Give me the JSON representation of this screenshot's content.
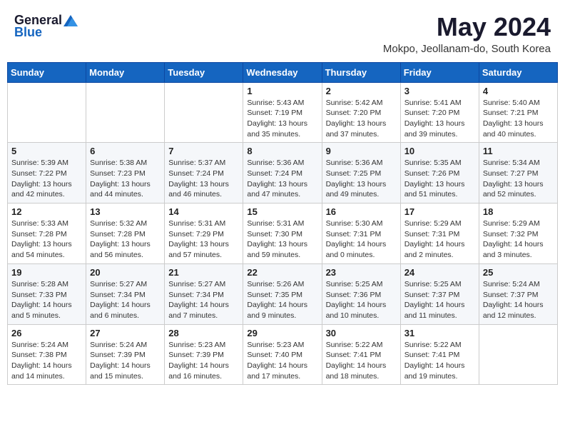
{
  "header": {
    "logo_general": "General",
    "logo_blue": "Blue",
    "month_title": "May 2024",
    "subtitle": "Mokpo, Jeollanam-do, South Korea"
  },
  "days_of_week": [
    "Sunday",
    "Monday",
    "Tuesday",
    "Wednesday",
    "Thursday",
    "Friday",
    "Saturday"
  ],
  "weeks": [
    [
      {
        "day": "",
        "info": ""
      },
      {
        "day": "",
        "info": ""
      },
      {
        "day": "",
        "info": ""
      },
      {
        "day": "1",
        "info": "Sunrise: 5:43 AM\nSunset: 7:19 PM\nDaylight: 13 hours\nand 35 minutes."
      },
      {
        "day": "2",
        "info": "Sunrise: 5:42 AM\nSunset: 7:20 PM\nDaylight: 13 hours\nand 37 minutes."
      },
      {
        "day": "3",
        "info": "Sunrise: 5:41 AM\nSunset: 7:20 PM\nDaylight: 13 hours\nand 39 minutes."
      },
      {
        "day": "4",
        "info": "Sunrise: 5:40 AM\nSunset: 7:21 PM\nDaylight: 13 hours\nand 40 minutes."
      }
    ],
    [
      {
        "day": "5",
        "info": "Sunrise: 5:39 AM\nSunset: 7:22 PM\nDaylight: 13 hours\nand 42 minutes."
      },
      {
        "day": "6",
        "info": "Sunrise: 5:38 AM\nSunset: 7:23 PM\nDaylight: 13 hours\nand 44 minutes."
      },
      {
        "day": "7",
        "info": "Sunrise: 5:37 AM\nSunset: 7:24 PM\nDaylight: 13 hours\nand 46 minutes."
      },
      {
        "day": "8",
        "info": "Sunrise: 5:36 AM\nSunset: 7:24 PM\nDaylight: 13 hours\nand 47 minutes."
      },
      {
        "day": "9",
        "info": "Sunrise: 5:36 AM\nSunset: 7:25 PM\nDaylight: 13 hours\nand 49 minutes."
      },
      {
        "day": "10",
        "info": "Sunrise: 5:35 AM\nSunset: 7:26 PM\nDaylight: 13 hours\nand 51 minutes."
      },
      {
        "day": "11",
        "info": "Sunrise: 5:34 AM\nSunset: 7:27 PM\nDaylight: 13 hours\nand 52 minutes."
      }
    ],
    [
      {
        "day": "12",
        "info": "Sunrise: 5:33 AM\nSunset: 7:28 PM\nDaylight: 13 hours\nand 54 minutes."
      },
      {
        "day": "13",
        "info": "Sunrise: 5:32 AM\nSunset: 7:28 PM\nDaylight: 13 hours\nand 56 minutes."
      },
      {
        "day": "14",
        "info": "Sunrise: 5:31 AM\nSunset: 7:29 PM\nDaylight: 13 hours\nand 57 minutes."
      },
      {
        "day": "15",
        "info": "Sunrise: 5:31 AM\nSunset: 7:30 PM\nDaylight: 13 hours\nand 59 minutes."
      },
      {
        "day": "16",
        "info": "Sunrise: 5:30 AM\nSunset: 7:31 PM\nDaylight: 14 hours\nand 0 minutes."
      },
      {
        "day": "17",
        "info": "Sunrise: 5:29 AM\nSunset: 7:31 PM\nDaylight: 14 hours\nand 2 minutes."
      },
      {
        "day": "18",
        "info": "Sunrise: 5:29 AM\nSunset: 7:32 PM\nDaylight: 14 hours\nand 3 minutes."
      }
    ],
    [
      {
        "day": "19",
        "info": "Sunrise: 5:28 AM\nSunset: 7:33 PM\nDaylight: 14 hours\nand 5 minutes."
      },
      {
        "day": "20",
        "info": "Sunrise: 5:27 AM\nSunset: 7:34 PM\nDaylight: 14 hours\nand 6 minutes."
      },
      {
        "day": "21",
        "info": "Sunrise: 5:27 AM\nSunset: 7:34 PM\nDaylight: 14 hours\nand 7 minutes."
      },
      {
        "day": "22",
        "info": "Sunrise: 5:26 AM\nSunset: 7:35 PM\nDaylight: 14 hours\nand 9 minutes."
      },
      {
        "day": "23",
        "info": "Sunrise: 5:25 AM\nSunset: 7:36 PM\nDaylight: 14 hours\nand 10 minutes."
      },
      {
        "day": "24",
        "info": "Sunrise: 5:25 AM\nSunset: 7:37 PM\nDaylight: 14 hours\nand 11 minutes."
      },
      {
        "day": "25",
        "info": "Sunrise: 5:24 AM\nSunset: 7:37 PM\nDaylight: 14 hours\nand 12 minutes."
      }
    ],
    [
      {
        "day": "26",
        "info": "Sunrise: 5:24 AM\nSunset: 7:38 PM\nDaylight: 14 hours\nand 14 minutes."
      },
      {
        "day": "27",
        "info": "Sunrise: 5:24 AM\nSunset: 7:39 PM\nDaylight: 14 hours\nand 15 minutes."
      },
      {
        "day": "28",
        "info": "Sunrise: 5:23 AM\nSunset: 7:39 PM\nDaylight: 14 hours\nand 16 minutes."
      },
      {
        "day": "29",
        "info": "Sunrise: 5:23 AM\nSunset: 7:40 PM\nDaylight: 14 hours\nand 17 minutes."
      },
      {
        "day": "30",
        "info": "Sunrise: 5:22 AM\nSunset: 7:41 PM\nDaylight: 14 hours\nand 18 minutes."
      },
      {
        "day": "31",
        "info": "Sunrise: 5:22 AM\nSunset: 7:41 PM\nDaylight: 14 hours\nand 19 minutes."
      },
      {
        "day": "",
        "info": ""
      }
    ]
  ]
}
